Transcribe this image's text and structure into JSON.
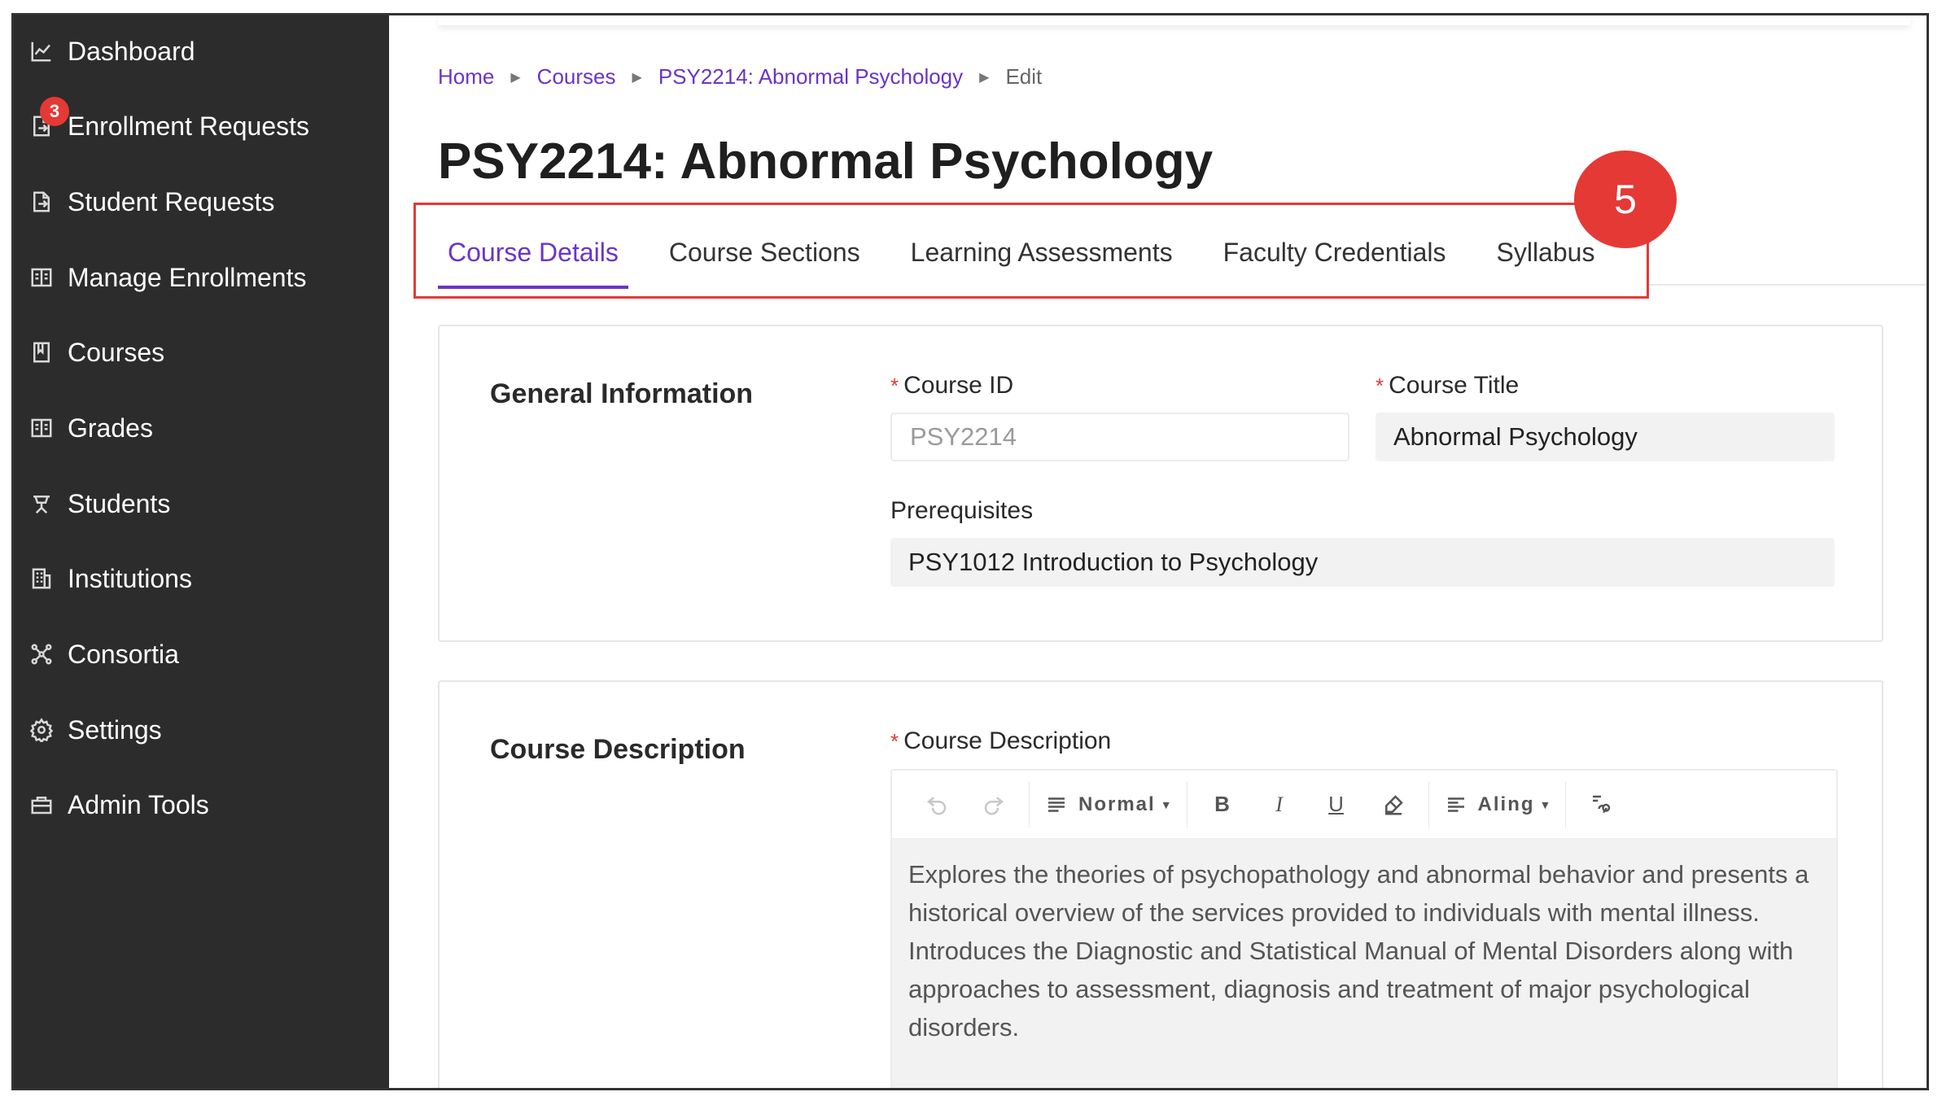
{
  "sidebar": {
    "items": [
      {
        "label": "Dashboard",
        "icon": "chart-line-icon"
      },
      {
        "label": "Enrollment Requests",
        "icon": "request-icon",
        "badge": "3"
      },
      {
        "label": "Student Requests",
        "icon": "request-icon"
      },
      {
        "label": "Manage Enrollments",
        "icon": "enrollments-icon"
      },
      {
        "label": "Courses",
        "icon": "book-icon"
      },
      {
        "label": "Grades",
        "icon": "grades-icon"
      },
      {
        "label": "Students",
        "icon": "student-icon"
      },
      {
        "label": "Institutions",
        "icon": "building-icon"
      },
      {
        "label": "Consortia",
        "icon": "network-icon"
      },
      {
        "label": "Settings",
        "icon": "gear-icon"
      },
      {
        "label": "Admin Tools",
        "icon": "toolbox-icon"
      }
    ]
  },
  "breadcrumb": {
    "home": "Home",
    "courses": "Courses",
    "course": "PSY2214: Abnormal Psychology",
    "current": "Edit"
  },
  "page": {
    "title": "PSY2214: Abnormal Psychology",
    "step": "5"
  },
  "tabs": [
    "Course Details",
    "Course Sections",
    "Learning Assessments",
    "Faculty Credentials",
    "Syllabus"
  ],
  "general": {
    "title": "General Information",
    "course_id_label": "Course ID",
    "course_id_value": "PSY2214",
    "course_title_label": "Course Title",
    "course_title_value": "Abnormal Psychology",
    "prereq_label": "Prerequisites",
    "prereq_value": "PSY1012 Introduction to Psychology",
    "required_mark": "*"
  },
  "description": {
    "title": "Course Description",
    "label": "Course Description",
    "required_mark": "*",
    "toolbar": {
      "paragraph_style": "Normal",
      "align": "Aling",
      "bold": "B",
      "italic": "I",
      "underline": "U"
    },
    "lines": [
      "Explores the theories of psychopathology and abnormal behavior and presents a",
      "historical overview of the services provided to individuals with mental illness.",
      "Introduces the Diagnostic and Statistical Manual of Mental Disorders along with",
      "approaches to assessment, diagnosis and treatment of major psychological",
      "disorders."
    ]
  },
  "colors": {
    "sidebar_bg": "#2c2c2c",
    "accent": "#6a34c9",
    "highlight": "#e53935"
  }
}
